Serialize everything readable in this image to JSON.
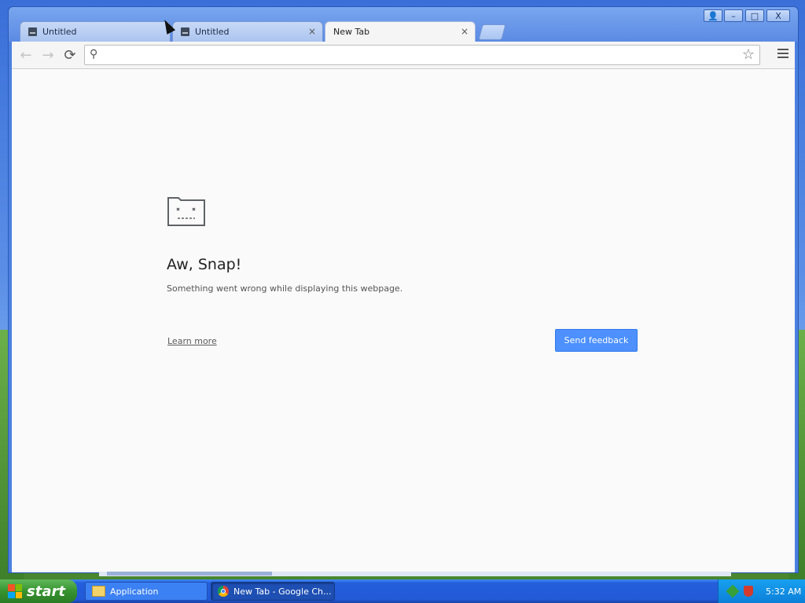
{
  "browser": {
    "tabs": [
      {
        "label": "Untitled",
        "close": "×",
        "icon": "sad-page-favicon-icon"
      },
      {
        "label": "Untitled",
        "close": "×",
        "icon": "sad-page-favicon-icon"
      },
      {
        "label": "New Tab",
        "close": "×",
        "active": true
      }
    ],
    "window_controls": {
      "profile": "👤",
      "minimize": "–",
      "maximize": "□",
      "close": "X"
    },
    "toolbar": {
      "back": "←",
      "forward": "→",
      "reload": "⟳",
      "omnibox_value": "",
      "omnibox_placeholder": "",
      "search_icon": "⚲",
      "star": "☆"
    }
  },
  "page": {
    "title": "Aw, Snap!",
    "message": "Something went wrong while displaying this webpage.",
    "learn_more": "Learn more",
    "send_feedback": "Send feedback"
  },
  "taskbar": {
    "start": "start",
    "items": [
      {
        "label": "Application",
        "icon": "folder-icon"
      },
      {
        "label": "New Tab - Google Ch...",
        "icon": "chrome-icon"
      }
    ],
    "clock": "5:32 AM"
  },
  "colors": {
    "accent_button": "#4d90fe",
    "taskbar_blue": "#245edb",
    "start_green": "#36922f"
  }
}
